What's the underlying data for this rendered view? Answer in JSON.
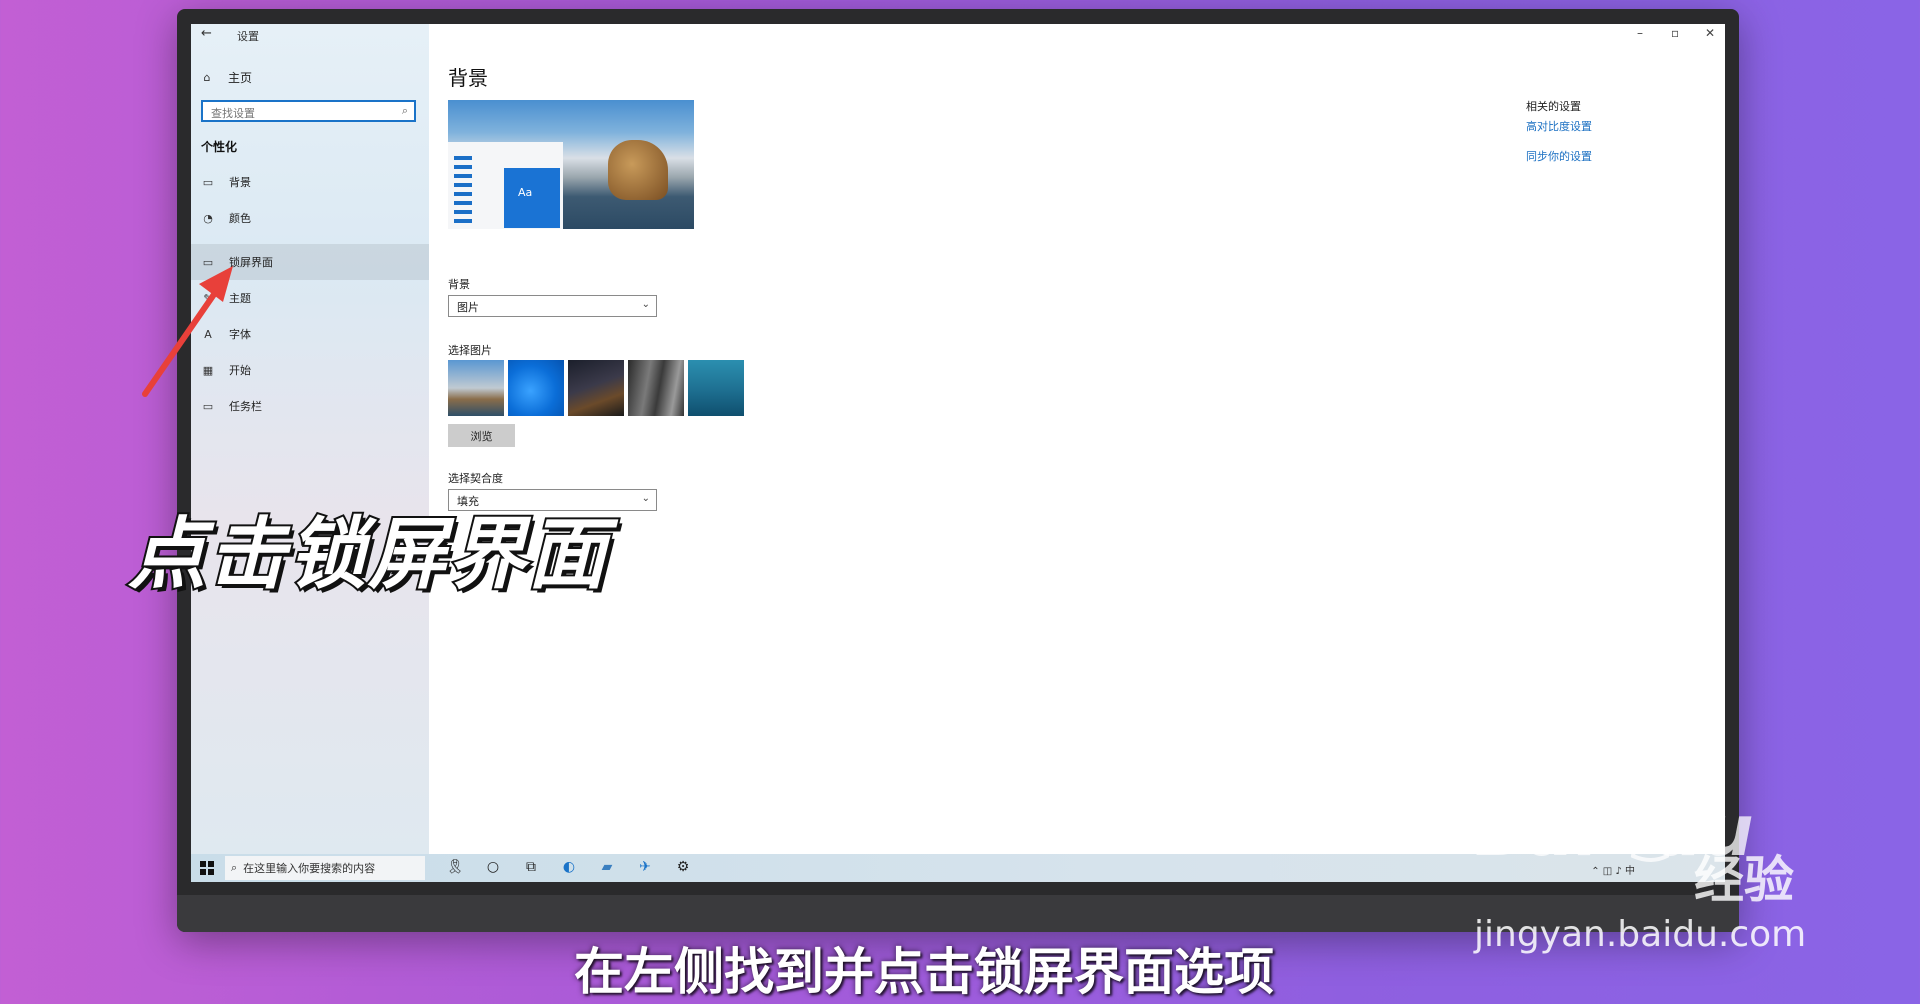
{
  "window": {
    "title": "设置",
    "back_icon": "back-arrow-icon",
    "controls": [
      "minimize-icon",
      "maximize-icon",
      "close-icon"
    ]
  },
  "sidebar": {
    "home_label": "主页",
    "search_placeholder": "查找设置",
    "section_title": "个性化",
    "items": [
      {
        "label": "背景",
        "icon": "picture-icon"
      },
      {
        "label": "颜色",
        "icon": "palette-icon"
      },
      {
        "label": "锁屏界面",
        "icon": "lock-screen-icon",
        "selected": true
      },
      {
        "label": "主题",
        "icon": "theme-icon"
      },
      {
        "label": "字体",
        "icon": "font-icon"
      },
      {
        "label": "开始",
        "icon": "start-icon"
      },
      {
        "label": "任务栏",
        "icon": "taskbar-icon"
      }
    ]
  },
  "main": {
    "page_title": "背景",
    "preview_tile_text": "Aa",
    "background_label": "背景",
    "background_value": "图片",
    "choose_picture_label": "选择图片",
    "browse_label": "浏览",
    "fit_label": "选择契合度",
    "fit_value": "填充"
  },
  "related": {
    "title": "相关的设置",
    "links": [
      "高对比度设置",
      "同步你的设置"
    ]
  },
  "taskbar": {
    "search_placeholder": "在这里输入你要搜索的内容"
  },
  "overlay": {
    "big_caption": "点击锁屏界面",
    "subtitle": "在左侧找到并点击锁屏界面选项",
    "watermark_logo": "Bai",
    "watermark_logo_tail": "du",
    "watermark_sub": "经验",
    "watermark_url": "jingyan.baidu.com"
  },
  "colors": {
    "accent": "#1a73c8",
    "arrow": "#e8403a",
    "background_gradient_start": "#c25fd4",
    "background_gradient_end": "#8a64e6"
  }
}
